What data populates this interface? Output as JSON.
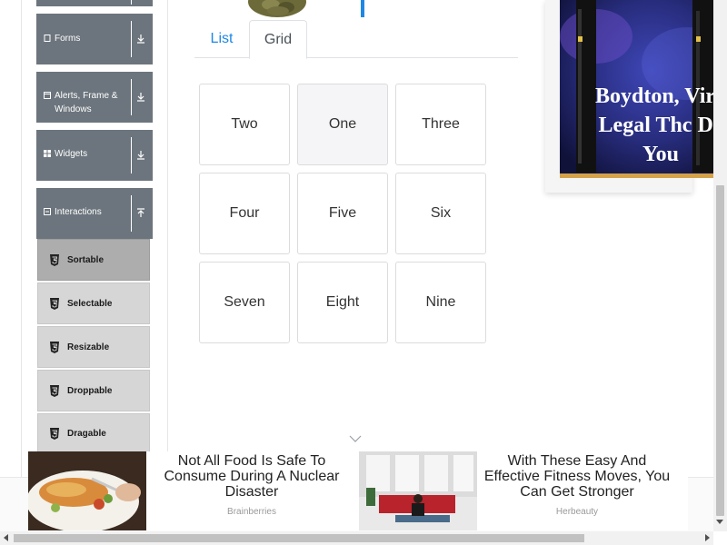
{
  "sidebar": {
    "groups": [
      {
        "label": "Forms",
        "icon": "document-icon"
      },
      {
        "label": "Alerts, Frame & Windows",
        "icon": "window-icon"
      },
      {
        "label": "Widgets",
        "icon": "grid-icon"
      },
      {
        "label": "Interactions",
        "icon": "collapse-square-icon"
      }
    ],
    "interaction_items": [
      {
        "label": "Sortable",
        "active": true
      },
      {
        "label": "Selectable",
        "active": false
      },
      {
        "label": "Resizable",
        "active": false
      },
      {
        "label": "Droppable",
        "active": false
      },
      {
        "label": "Dragable",
        "active": false
      }
    ]
  },
  "tabs": {
    "list": "List",
    "grid": "Grid",
    "selected": "Grid"
  },
  "grid_items": [
    "Two",
    "One",
    "Three",
    "Four",
    "Five",
    "Six",
    "Seven",
    "Eight",
    "Nine"
  ],
  "ad_right": {
    "lines": [
      "Boydton, Virg",
      "Legal Thc De",
      "You"
    ]
  },
  "bottom_ads": [
    {
      "headline": "Not All Food Is Safe To Consume During A Nuclear Disaster",
      "source": "Brainberries"
    },
    {
      "headline": "With These Easy And Effective Fitness Moves, You Can Get Stronger",
      "source": "Herbeauty"
    }
  ],
  "colors": {
    "accent": "#1e88e5",
    "sidebar_group": "#6c757d",
    "sub_item": "#d6d6d6",
    "sub_item_active": "#adadad"
  }
}
